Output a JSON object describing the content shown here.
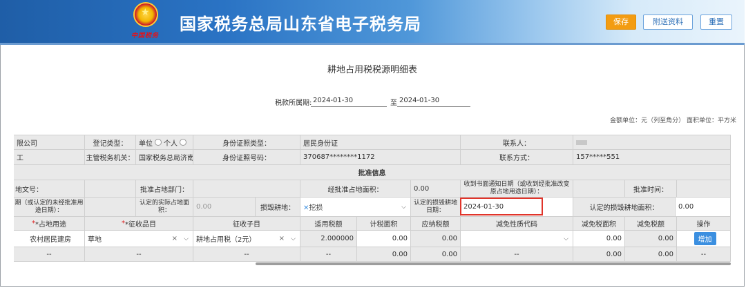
{
  "header": {
    "title": "国家税务总局山东省电子税务局",
    "slogan": "中国税务",
    "save_label": "保存",
    "attach_label": "附送资料",
    "reset_label": "重置"
  },
  "doc": {
    "title": "耕地占用税税源明细表",
    "period_label": "税款所属期:",
    "period_start": "2024-01-30",
    "period_to": "至",
    "period_end": "2024-01-30",
    "unit_note": "金额单位：元（列至角分） 面积单位：平方米"
  },
  "taxpayer": {
    "name_value": "限公司",
    "reg_type_label": "登记类型：",
    "reg_type_opt1": "单位",
    "reg_type_opt2": "个人",
    "id_type_label": "身份证照类型：",
    "id_type_value": "居民身份证",
    "contact_label": "联系人：",
    "row2_left": "工",
    "tax_office_label": "主管税务机关：",
    "tax_office_value": "国家税务总局济南",
    "id_no_label": "身份证照号码：",
    "id_no_value": "370687********1172",
    "phone_label": "联系方式：",
    "phone_value": "157*****551"
  },
  "approval": {
    "section_label": "批准信息",
    "doc_no_label": "地文号：",
    "dept_label": "批准占地部门：",
    "area_label": "经批准占地面积：",
    "area_value": "0.00",
    "notice_date_label": "收到书面通知日期（或收到经批准改变原占地用途日期）：",
    "approve_time_label": "批准时间：",
    "unapproved_label": "期（或认定的未经批准用途日期）：",
    "actual_area_label": "认定的实际占地面积：",
    "actual_area_value": "0.00",
    "damage_label": "损毁耕地：",
    "damage_tag": "挖损",
    "damage_date_label": "认定的损毁耕地日期：",
    "damage_date_value": "2024-01-30",
    "damage_area_label": "认定的损毁耕地面积：",
    "damage_area_value": "0.00"
  },
  "table": {
    "headers": [
      "*占地用途",
      "*征收品目",
      "征收子目",
      "适用税额",
      "计税面积",
      "应纳税额",
      "减免性质代码",
      "减免税面积",
      "减免税额",
      "操作"
    ],
    "row1": {
      "use": "农村居民建房",
      "item": "草地",
      "sub_item": "耕地占用税（2元）",
      "rate": "2.000000",
      "taxable_area": "0.00",
      "tax_payable": "0.00",
      "relief_code": "",
      "relief_area": "0.00",
      "relief_amount": "0.00",
      "action": "增加"
    },
    "row2": {
      "c0": "--",
      "c1": "--",
      "c2": "--",
      "c3": "--",
      "c4": "0.00",
      "c5": "0.00",
      "c6": "--",
      "c7": "0.00",
      "c8": "0.00",
      "c9": "--"
    }
  }
}
